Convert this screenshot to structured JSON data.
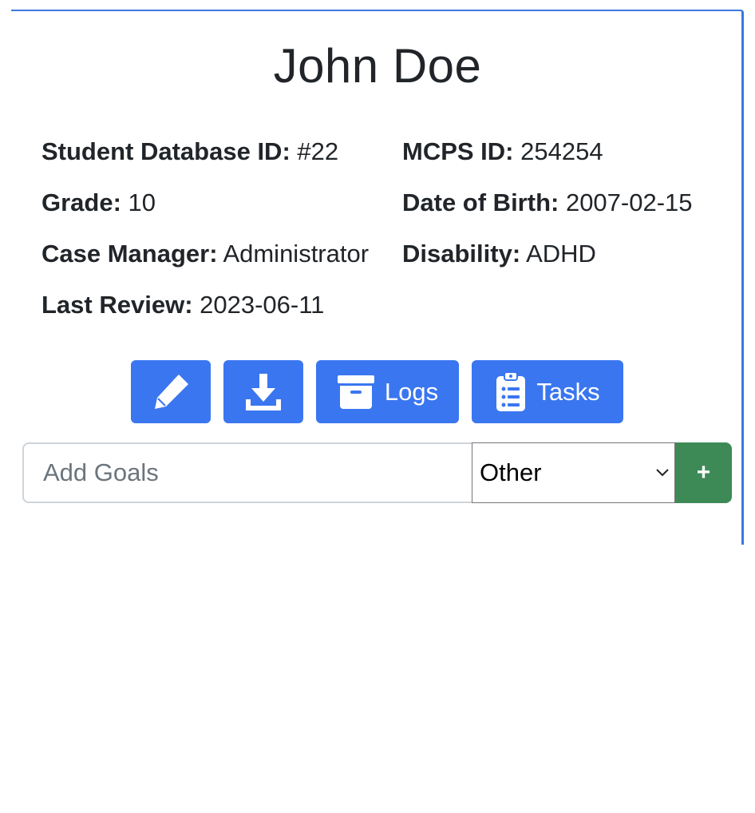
{
  "student": {
    "name": "John Doe",
    "fields": {
      "db_id": {
        "label": "Student Database ID:",
        "value": "#22"
      },
      "mcps_id": {
        "label": "MCPS ID:",
        "value": "254254"
      },
      "grade": {
        "label": "Grade:",
        "value": "10"
      },
      "dob": {
        "label": "Date of Birth:",
        "value": "2007-02-15"
      },
      "case_manager": {
        "label": "Case Manager:",
        "value": "Administrator"
      },
      "disability": {
        "label": "Disability:",
        "value": "ADHD"
      },
      "last_review": {
        "label": "Last Review:",
        "value": "2023-06-11"
      }
    }
  },
  "actions": {
    "edit_icon": "pencil-icon",
    "download_icon": "download-icon",
    "logs": {
      "label": "Logs",
      "icon": "archive-box-icon"
    },
    "tasks": {
      "label": "Tasks",
      "icon": "clipboard-list-icon"
    },
    "color": "#3a76f0"
  },
  "goal_form": {
    "placeholder": "Add Goals",
    "category_selected": "Other",
    "add_label": "+",
    "add_color": "#3e8a57"
  }
}
